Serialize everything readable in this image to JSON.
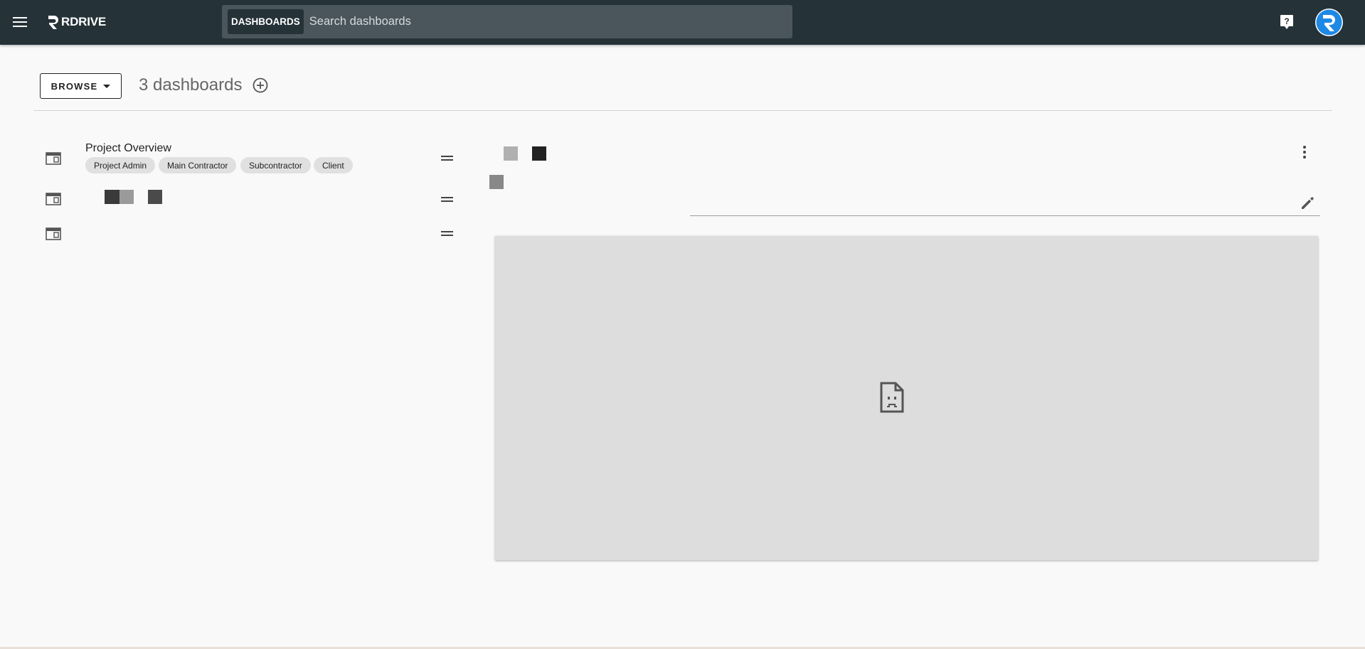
{
  "app": {
    "brand": "RDRIVE",
    "colors": {
      "appbar": "#253238",
      "search_bg": "#4a565b",
      "accent": "#1e88e5"
    }
  },
  "header": {
    "menu_icon": "hamburger-icon",
    "search_chip": "DASHBOARDS",
    "search_placeholder": "Search dashboards",
    "help_icon": "help-icon"
  },
  "toolbar": {
    "browse_label": "BROWSE",
    "count_label": "3 dashboards",
    "add_icon": "add-circle-icon"
  },
  "dashboards": [
    {
      "title": "Project Overview",
      "tags": [
        "Project Admin",
        "Main Contractor",
        "Subcontractor",
        "Client"
      ]
    },
    {
      "title": "",
      "tags": []
    },
    {
      "title": "",
      "tags": []
    }
  ],
  "detail": {
    "more_icon": "more-vert-icon",
    "edit_icon": "edit-icon",
    "preview_icon": "broken-page-icon"
  }
}
